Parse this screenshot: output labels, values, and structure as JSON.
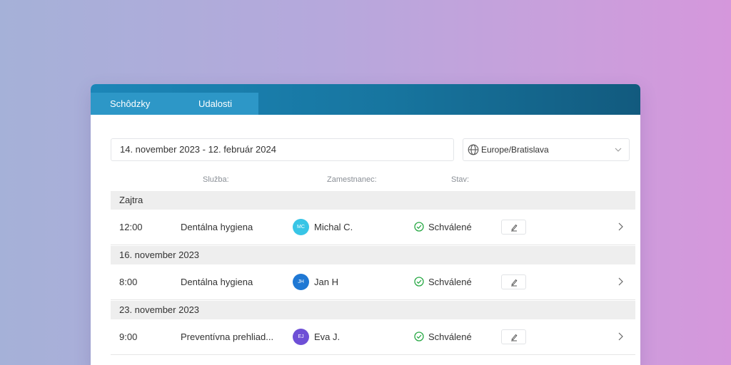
{
  "tabs": [
    {
      "label": "Schôdzky",
      "active": true
    },
    {
      "label": "Udalosti",
      "active": false
    }
  ],
  "filters": {
    "date_range": "14. november 2023 - 12. február 2024",
    "timezone": "Europe/Bratislava"
  },
  "columns": {
    "service": "Služba:",
    "employee": "Zamestnanec:",
    "status": "Stav:"
  },
  "groups": [
    {
      "label": "Zajtra",
      "rows": [
        {
          "time": "12:00",
          "service": "Dentálna hygiena",
          "initials": "MC",
          "employee": "Michal C.",
          "status": "Schválené",
          "avatar_color": "#38c5e6"
        }
      ]
    },
    {
      "label": "16. november 2023",
      "rows": [
        {
          "time": "8:00",
          "service": "Dentálna hygiena",
          "initials": "JH",
          "employee": "Jan H",
          "status": "Schválené",
          "avatar_color": "#1f78d4"
        }
      ]
    },
    {
      "label": "23. november 2023",
      "rows": [
        {
          "time": "9:00",
          "service": "Preventívna prehliad...",
          "initials": "EJ",
          "employee": "Eva J.",
          "status": "Schválené",
          "avatar_color": "#6e4fd6"
        }
      ]
    }
  ],
  "colors": {
    "header": "#1c86b8",
    "status_ok": "#27a844"
  }
}
